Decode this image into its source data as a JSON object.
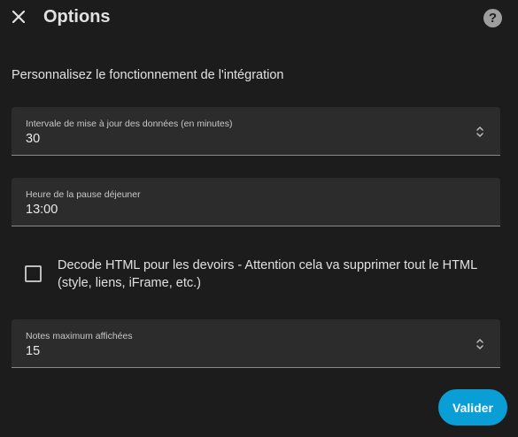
{
  "dialog": {
    "title": "Options",
    "help_glyph": "?",
    "description": "Personnalisez le fonctionnement de l'intégration"
  },
  "fields": [
    {
      "label": "Intervale de mise à jour des données (en minutes)",
      "value": "30"
    },
    {
      "label": "Heure de la pause déjeuner",
      "value": "13:00"
    },
    {
      "label": "Notes maximum affichées",
      "value": "15"
    }
  ],
  "checkbox": {
    "label": "Decode HTML pour les devoirs - Attention cela va supprimer tout le HTML (style, liens, iFrame, etc.)",
    "checked": false
  },
  "actions": {
    "submit_label": "Valider"
  },
  "colors": {
    "accent": "#0a9ed6",
    "background": "#1c1c1c",
    "field_background": "#2c2c2c"
  },
  "icons": [
    "close-icon",
    "help-icon",
    "stepper-icon"
  ]
}
